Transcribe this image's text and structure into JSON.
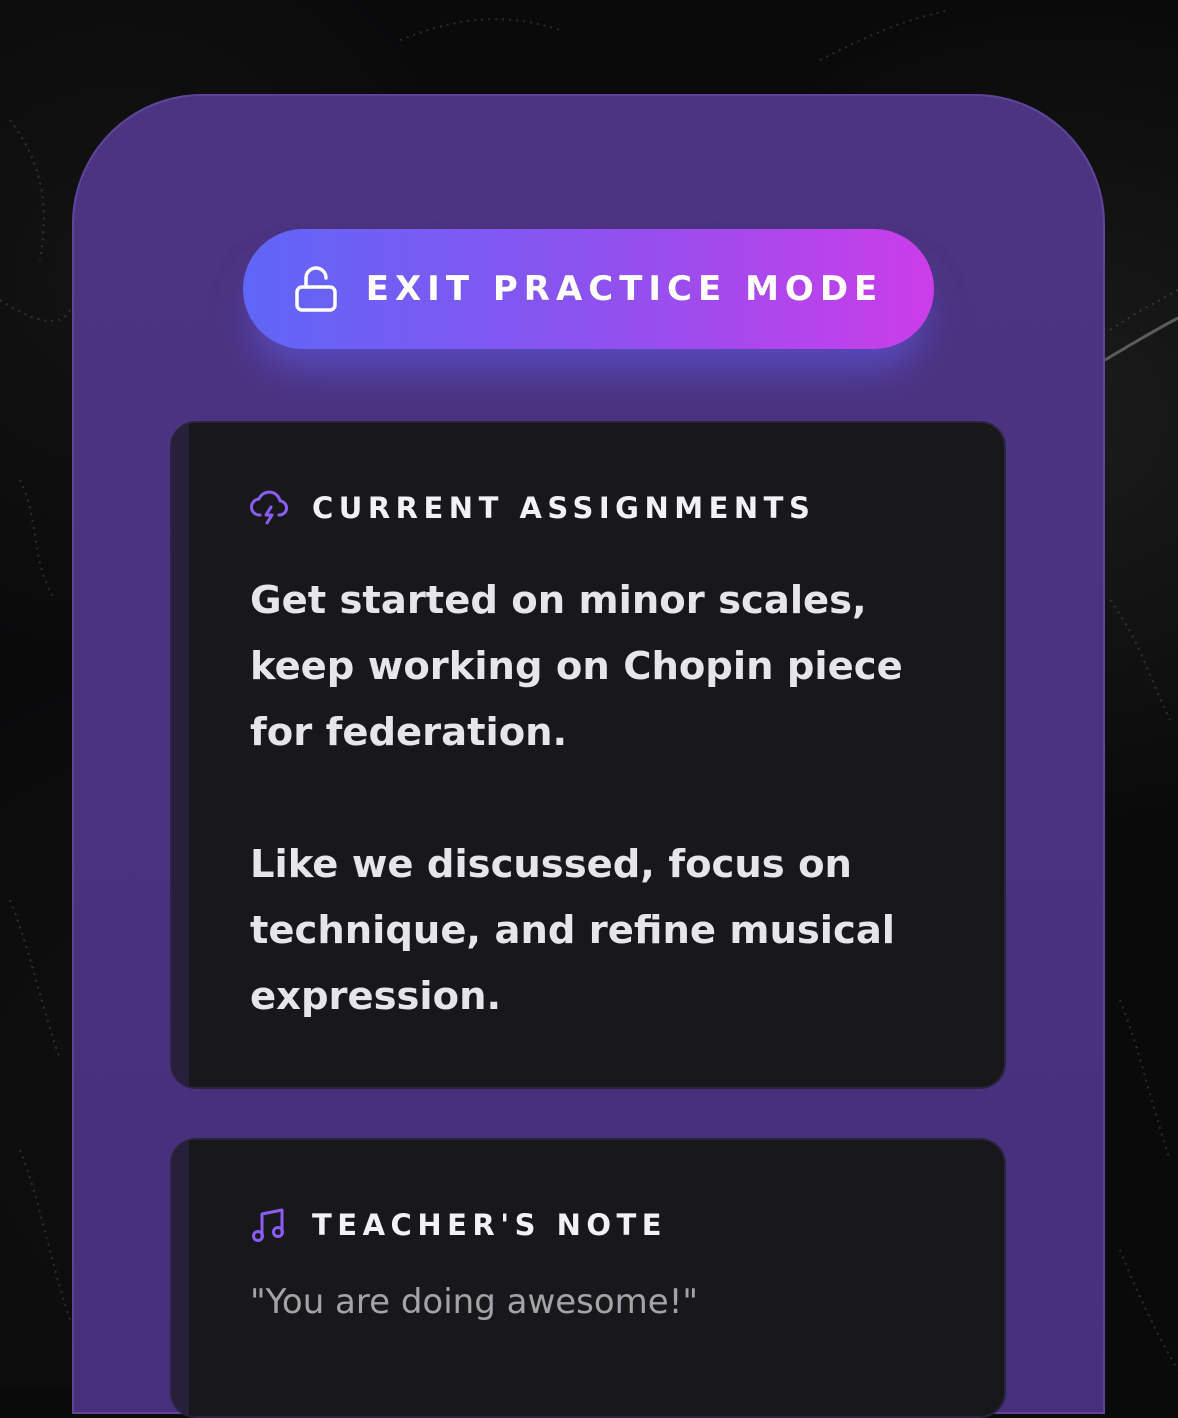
{
  "colors": {
    "panel": "#4a327e",
    "card": "#18181b",
    "accent_start": "#5f66f7",
    "accent_end": "#cb3de9",
    "icon_purple": "#8b5cf6"
  },
  "exit_button": {
    "label": "EXIT PRACTICE MODE",
    "icon": "unlock-icon"
  },
  "assignments": {
    "icon": "cloud-lightning-icon",
    "title": "CURRENT ASSIGNMENTS",
    "paragraphs": [
      "Get started on minor scales, keep working on Chopin piece for federation.",
      "Like we discussed, focus on technique, and refine musical expression."
    ]
  },
  "teacher_note": {
    "icon": "music-note-icon",
    "title": "TEACHER'S NOTE",
    "text": "\"You are doing awesome!\""
  }
}
